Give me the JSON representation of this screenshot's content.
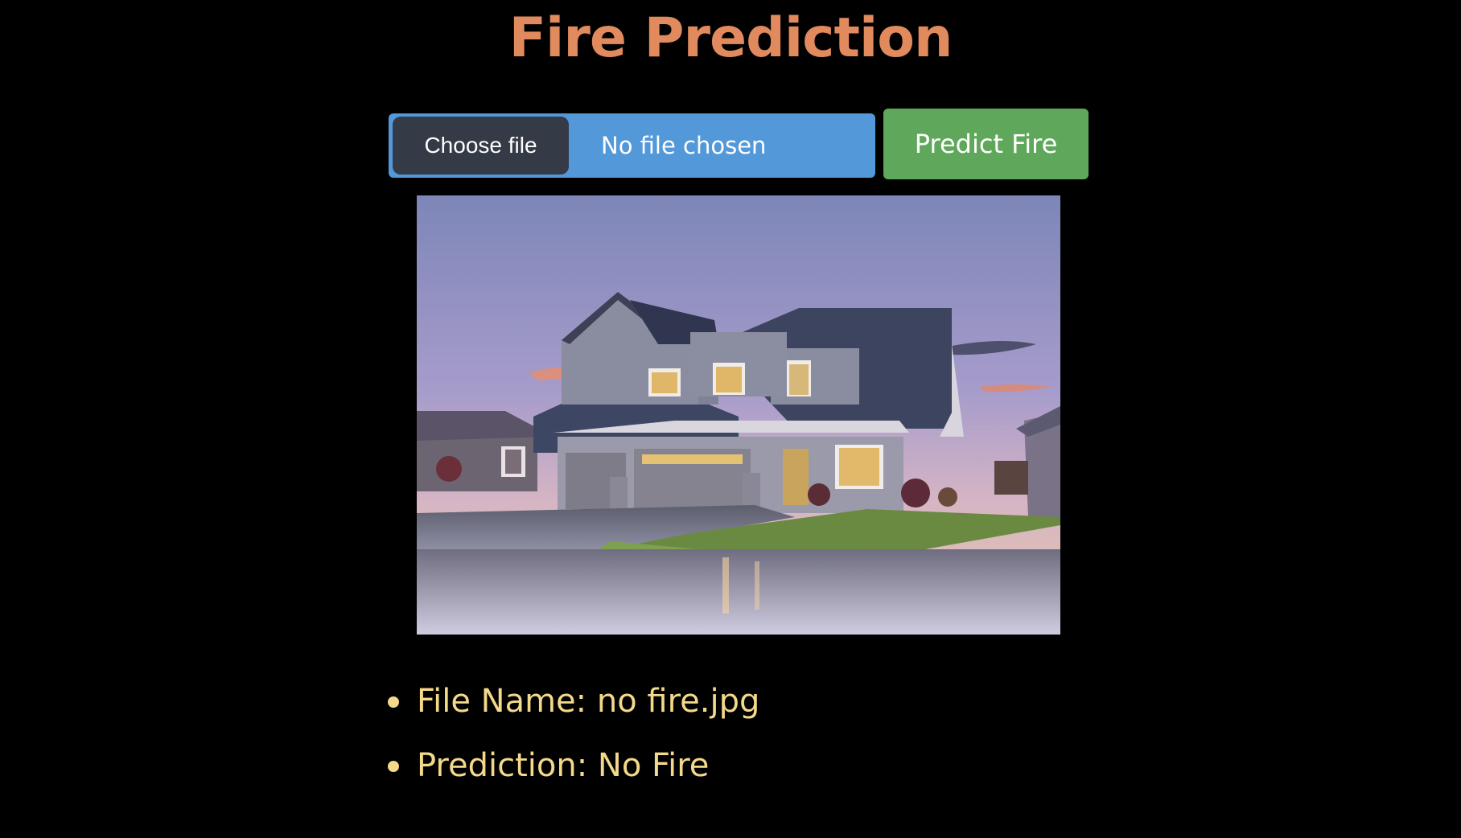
{
  "page": {
    "title": "Fire Prediction"
  },
  "upload": {
    "choose_label": "Choose file",
    "status_text": "No file chosen"
  },
  "actions": {
    "predict_label": "Predict Fire"
  },
  "preview": {
    "description": ""
  },
  "results": {
    "items": [
      {
        "text": "File Name: no fire.jpg"
      },
      {
        "text": "Prediction: No Fire"
      }
    ]
  },
  "colors": {
    "background": "#000000",
    "title": "#e08a5e",
    "file_input_bg": "#5398d9",
    "choose_button_bg": "#353b46",
    "predict_button_bg": "#5fa75a",
    "result_text": "#f4d98a"
  }
}
